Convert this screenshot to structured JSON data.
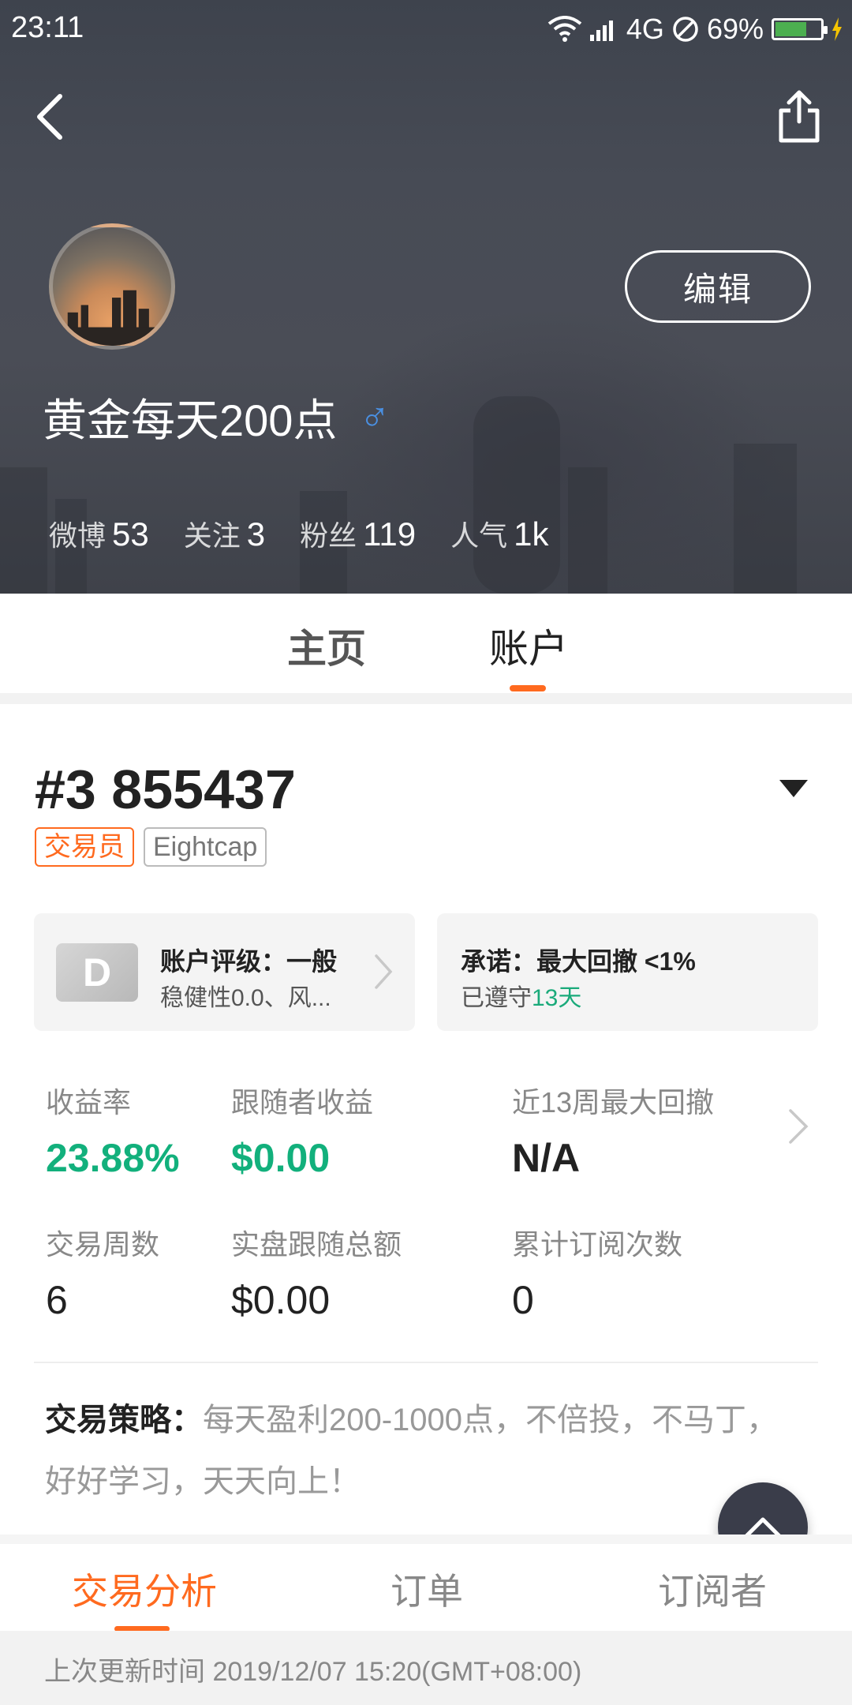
{
  "status_bar": {
    "time": "23:11",
    "network": "4G",
    "battery_percent": "69%",
    "battery_level": 0.69
  },
  "profile": {
    "name": "黄金每天200点",
    "gender_symbol": "♂",
    "edit_label": "编辑",
    "stats": [
      {
        "label": "微博",
        "value": "53"
      },
      {
        "label": "关注",
        "value": "3"
      },
      {
        "label": "粉丝",
        "value": "119"
      },
      {
        "label": "人气",
        "value": "1k"
      }
    ]
  },
  "tabs": {
    "home": "主页",
    "account": "账户",
    "active": "account"
  },
  "account": {
    "number": "#3 855437",
    "tags": [
      "交易员",
      "Eightcap"
    ],
    "rating": {
      "grade": "D",
      "title": "账户评级：一般",
      "subtitle": "稳健性0.0、风..."
    },
    "promise": {
      "title": "承诺：最大回撤 <1%",
      "prefix": "已遵守",
      "days": "13天"
    },
    "metrics": [
      {
        "label": "收益率",
        "value": "23.88%"
      },
      {
        "label": "跟随者收益",
        "value": "$0.00"
      },
      {
        "label": "近13周最大回撤",
        "value": "N/A"
      },
      {
        "label": "交易周数",
        "value": "6"
      },
      {
        "label": "实盘跟随总额",
        "value": "$0.00"
      },
      {
        "label": "累计订阅次数",
        "value": "0"
      }
    ],
    "strategy_label": "交易策略：",
    "strategy_text": "每天盈利200-1000点，不倍投，不马丁，好好学习，天天向上！"
  },
  "sub_tabs": {
    "analysis": "交易分析",
    "orders": "订单",
    "subscribers": "订阅者",
    "active": "analysis"
  },
  "update": {
    "text": "上次更新时间 2019/12/07 15:20(GMT+08:00)"
  },
  "colors": {
    "accent": "#ff6a1f",
    "positive": "#12b07c",
    "gender": "#4a90e2"
  }
}
